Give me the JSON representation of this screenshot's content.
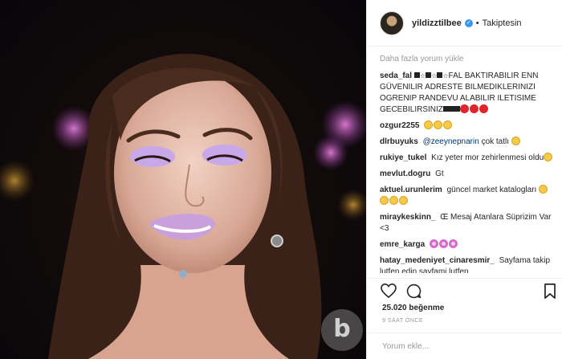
{
  "post": {
    "username": "yildizztilbee",
    "follow_status": "Takiptesin",
    "dot": "•",
    "likes": "25.020 beğenme",
    "time_ago": "9 SAAT ÖNCE",
    "add_comment_placeholder": "Yorum ekle...",
    "load_more": "Daha fazla yorum yükle",
    "watermark": "b"
  },
  "comments": [
    {
      "user": "seda_fal",
      "text": "FAL BAKTIRABILIR ENN GÜVENILIR ADRESTE BILMEDIKLERINIZI OGRENIP RANDEVU ALABILIR ILETISIME GECEBILIRSINIZ"
    },
    {
      "user": "ozgur2255",
      "text": ""
    },
    {
      "user": "dlrbuyuks",
      "mention": "@zeeynepnarin",
      "text": "çok tatlı"
    },
    {
      "user": "rukiye_tukel",
      "text": "Kız yeter mor zehirlenmesi oldu"
    },
    {
      "user": "mevlut.dogru",
      "text": "Gt"
    },
    {
      "user": "aktuel.urunlerim",
      "text": "güncel market katalogları"
    },
    {
      "user": "miraykeskinn_",
      "text": "Œ Mesaj Atanlara Süprizim Var <3"
    },
    {
      "user": "emre_karga",
      "text": ""
    },
    {
      "user": "hatay_medeniyet_cinaresmir_",
      "text": "Sayfama takip lutfen edin sayfami lutfen"
    }
  ],
  "colors": {
    "accent_blue": "#3897f0",
    "muted_text": "#999999",
    "border": "#efefef",
    "eyeshadow": "#c8a8e8",
    "lipstick": "#c9a0dc"
  },
  "icons": [
    "heart-icon",
    "comment-icon",
    "bookmark-icon",
    "verified-badge-icon"
  ]
}
